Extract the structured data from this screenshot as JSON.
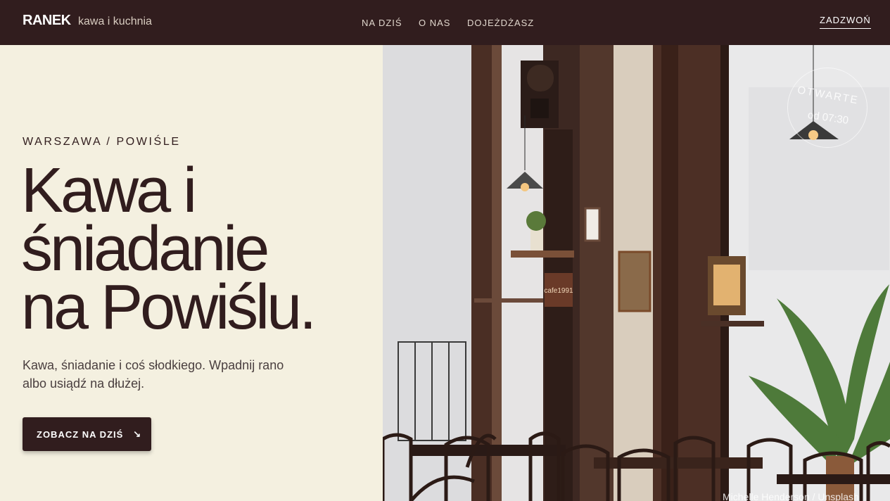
{
  "header": {
    "logo": "RANEK",
    "tagline": "kawa i kuchnia",
    "nav": [
      "NA DZIŚ",
      "O NAS",
      "DOJEŻDŻASZ"
    ],
    "call": "ZADZWOŃ"
  },
  "hero": {
    "eyebrow": "WARSZAWA / POWIŚLE",
    "title_lines": [
      "Kawa i",
      "śniadanie",
      "na Powiślu."
    ],
    "lead": "Kawa, śniadanie i coś słodkiego. Wpadnij rano albo usiądź na dłużej.",
    "cta": "ZOBACZ NA DZIŚ",
    "cta_icon": "arrow-down-right-icon"
  },
  "photo": {
    "badge_top": "OTWARTE",
    "badge_bottom": "od 07:30",
    "credit": "Michelle Henderson / Unsplash",
    "shop_sign": "cafe1991"
  },
  "colors": {
    "brand_dark": "#311d1e",
    "background": "#f4f0e0"
  }
}
